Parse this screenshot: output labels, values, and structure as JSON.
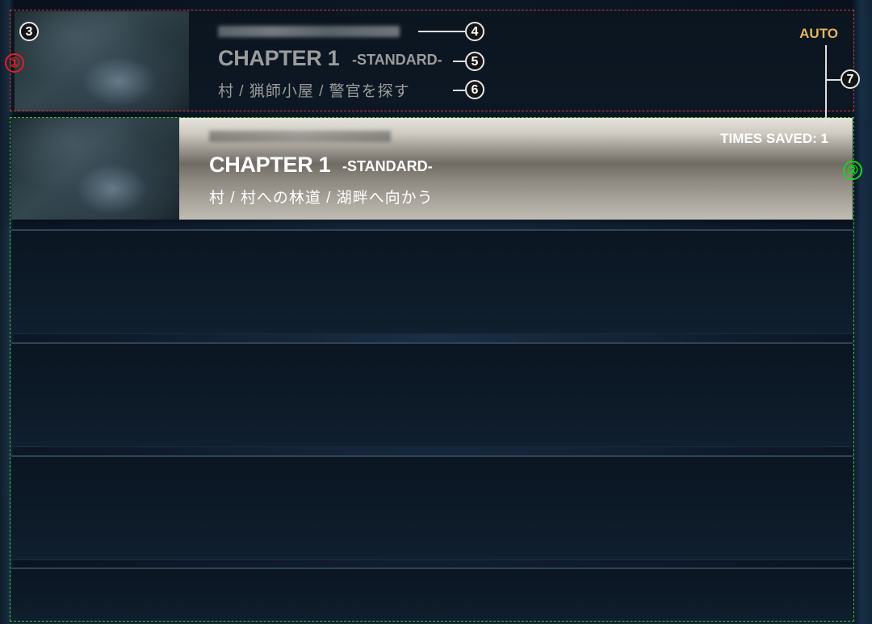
{
  "save_slots": [
    {
      "chapter": "CHAPTER 1",
      "difficulty": "-STANDARD-",
      "location": "村 / 猟師小屋 / 警官を探す",
      "tag": "AUTO"
    },
    {
      "chapter": "CHAPTER 1",
      "difficulty": "-STANDARD-",
      "location": "村 / 村への林道 / 湖畔へ向かう",
      "times_saved": "TIMES SAVED: 1"
    }
  ],
  "callouts": [
    "①",
    "②",
    "3",
    "4",
    "5",
    "6",
    "7"
  ],
  "colors": {
    "auto_tag": "#e6b45a",
    "callout_red": "#e02020",
    "callout_green": "#20d020"
  }
}
